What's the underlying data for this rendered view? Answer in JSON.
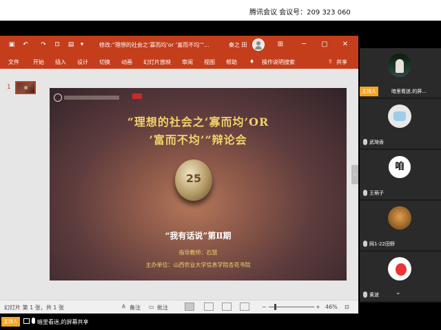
{
  "meeting": {
    "info": "腾讯会议 会议号：209 323 060"
  },
  "ppt": {
    "doc_title": "修改:“理想的社会之‘寡而均’or ‘富而不均’”...",
    "user_name": "秦之 田",
    "window_buttons": [
      "─",
      "▢",
      "✕"
    ],
    "menu": {
      "file": "文件",
      "home": "开始",
      "insert": "插入",
      "design": "设计",
      "transitions": "切换",
      "animations": "动画",
      "slideshow": "幻灯片放映",
      "review": "审阅",
      "view": "视图",
      "help": "帮助",
      "tell_me": "操作说明搜索",
      "share": "共享"
    },
    "thumbnail_number": "1",
    "slide": {
      "title_line1": "“理想的社会之‘寡而均’OR",
      "title_line2": "‘富而不均’”辩论会",
      "subtitle": "“我有话说”第Ⅱ期",
      "teacher": "指导教师：石慧",
      "host": "主办单位：山西农业大学信息学院杏花书院"
    },
    "status": {
      "slide_count": "幻灯片 第 1 张，共 1 张",
      "notes": "备注",
      "comments": "批注",
      "zoom": "46%"
    }
  },
  "participants": {
    "host_tag": "主持人",
    "host_name": "暗里看迷,的屏...",
    "list": [
      {
        "name": "武琦香"
      },
      {
        "name": "王萌子"
      },
      {
        "name": "网1-22田野"
      },
      {
        "name": "黄波"
      }
    ]
  },
  "share": {
    "host_tag": "主持人",
    "text": "暗里看迷,的屏幕共享"
  },
  "icons": {
    "save": "save-icon",
    "undo": "undo-icon",
    "redo": "redo-icon",
    "lightbulb": "lightbulb-icon"
  }
}
